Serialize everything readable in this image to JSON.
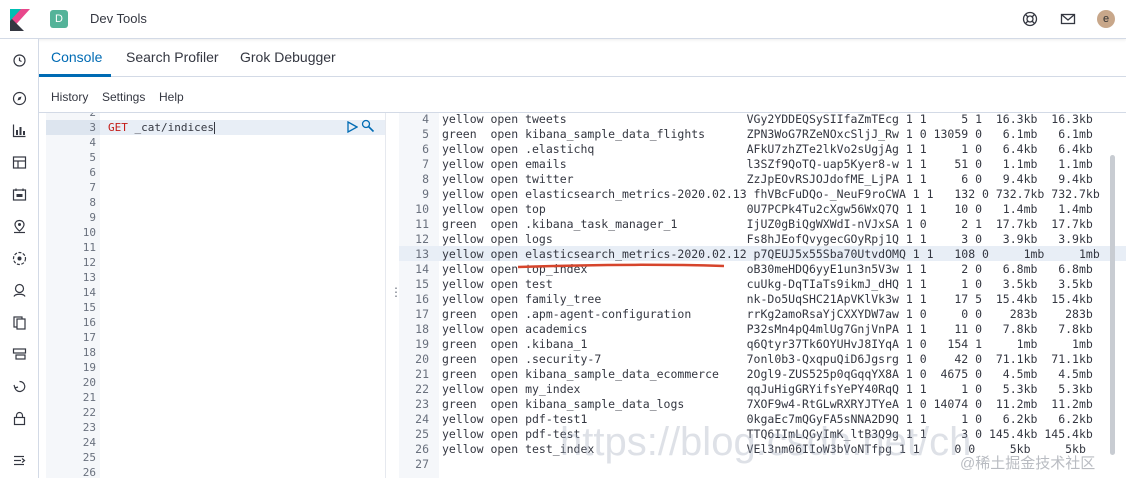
{
  "header": {
    "app_badge": "D",
    "app_title": "Dev Tools",
    "avatar_initial": "e"
  },
  "tabs": [
    "Console",
    "Search Profiler",
    "Grok Debugger"
  ],
  "submenu": [
    "History",
    "Settings",
    "Help"
  ],
  "editor": {
    "line_numbers": [
      "2",
      "3",
      "4",
      "5",
      "6",
      "7",
      "8",
      "9",
      "10",
      "11",
      "12",
      "13",
      "14",
      "15",
      "16",
      "17",
      "18",
      "19",
      "20",
      "21",
      "22",
      "23",
      "24",
      "25",
      "26"
    ],
    "active_line": "3",
    "request_method": "GET",
    "request_path": " _cat/indices"
  },
  "output": {
    "rows": [
      {
        "ln": "4",
        "text": "yellow open tweets                          VGy2YDDEQSySIIfaZmTEcg 1 1     5 1  16.3kb  16.3kb"
      },
      {
        "ln": "5",
        "text": "green  open kibana_sample_data_flights      ZPN3WoG7RZeNOxcSljJ_Rw 1 0 13059 0   6.1mb   6.1mb"
      },
      {
        "ln": "6",
        "text": "yellow open .elastichq                      AFkU7zhZTe2lkVo2sUgjAg 1 1     1 0   6.4kb   6.4kb"
      },
      {
        "ln": "7",
        "text": "yellow open emails                          l3SZf9QoTQ-uap5Kyer8-w 1 1    51 0   1.1mb   1.1mb"
      },
      {
        "ln": "8",
        "text": "yellow open twitter                         ZzJpEOvRSJOJdofME_LjPA 1 1     6 0   9.4kb   9.4kb"
      },
      {
        "ln": "9",
        "text": "yellow open elasticsearch_metrics-2020.02.13 fhVBcFuDQo-_NeuF9roCWA 1 1   132 0 732.7kb 732.7kb"
      },
      {
        "ln": "10",
        "text": "yellow open top                             0U7PCPk4Tu2cXgw56WxQ7Q 1 1    10 0   1.4mb   1.4mb"
      },
      {
        "ln": "11",
        "text": "green  open .kibana_task_manager_1          IjUZ0gBiQgWXWdI-nVJxSA 1 0     2 1  17.7kb  17.7kb"
      },
      {
        "ln": "12",
        "text": "yellow open logs                            Fs8hJEofQvygecGOyRpj1Q 1 1     3 0   3.9kb   3.9kb"
      },
      {
        "ln": "13",
        "text": "yellow open elasticsearch_metrics-2020.02.12 p7QEUJ5x55Sba70UtvdOMQ 1 1   108 0     1mb     1mb"
      },
      {
        "ln": "14",
        "text": "yellow open top_index                       oB30meHDQ6yyE1un3n5V3w 1 1     2 0   6.8mb   6.8mb"
      },
      {
        "ln": "15",
        "text": "yellow open test                            cuUkg-DqTIaTs9ikmJ_dHQ 1 1     1 0   3.5kb   3.5kb"
      },
      {
        "ln": "16",
        "text": "yellow open family_tree                     nk-Do5UqSHC21ApVKlVk3w 1 1    17 5  15.4kb  15.4kb"
      },
      {
        "ln": "17",
        "text": "green  open .apm-agent-configuration        rrKg2amoRsaYjCXXYDW7aw 1 0     0 0    283b    283b"
      },
      {
        "ln": "18",
        "text": "yellow open academics                       P32sMn4pQ4mlUg7GnjVnPA 1 1    11 0   7.8kb   7.8kb"
      },
      {
        "ln": "19",
        "text": "green  open .kibana_1                       q6Qtyr37Tk6OYUHvJ8IYqA 1 0   154 1     1mb     1mb"
      },
      {
        "ln": "20",
        "text": "green  open .security-7                     7onl0b3-QxqpuQiD6Jgsrg 1 0    42 0  71.1kb  71.1kb"
      },
      {
        "ln": "21",
        "text": "green  open kibana_sample_data_ecommerce    2Ogl9-ZUS525p0qGqqYX8A 1 0  4675 0   4.5mb   4.5mb"
      },
      {
        "ln": "22",
        "text": "yellow open my_index                        qqJuHigGRYifsYePY40RqQ 1 1     1 0   5.3kb   5.3kb"
      },
      {
        "ln": "23",
        "text": "green  open kibana_sample_data_logs         7XOF9w4-RtGLwRXRYJTYeA 1 0 14074 0  11.2mb  11.2mb"
      },
      {
        "ln": "24",
        "text": "yellow open pdf-test1                       0kgaEc7mQGyFA5sNNA2D9Q 1 1     1 0   6.2kb   6.2kb"
      },
      {
        "ln": "25",
        "text": "yellow open pdf-test                        TTQ6IImLQGyImK_ltB3Q9g 1 1     3 0 145.4kb 145.4kb"
      },
      {
        "ln": "26",
        "text": "yellow open test_index                      VEl3nm06IIoW3bVoNTfpg 1 1     0 0     5kb     5kb"
      },
      {
        "ln": "27",
        "text": ""
      }
    ]
  },
  "watermark": "@稀土掘金技术社区",
  "watermark_url": "https://blog.csdn.net/ch",
  "colors": {
    "accent": "#006bb4",
    "method": "#c41a16",
    "annotation": "#d6452c"
  }
}
